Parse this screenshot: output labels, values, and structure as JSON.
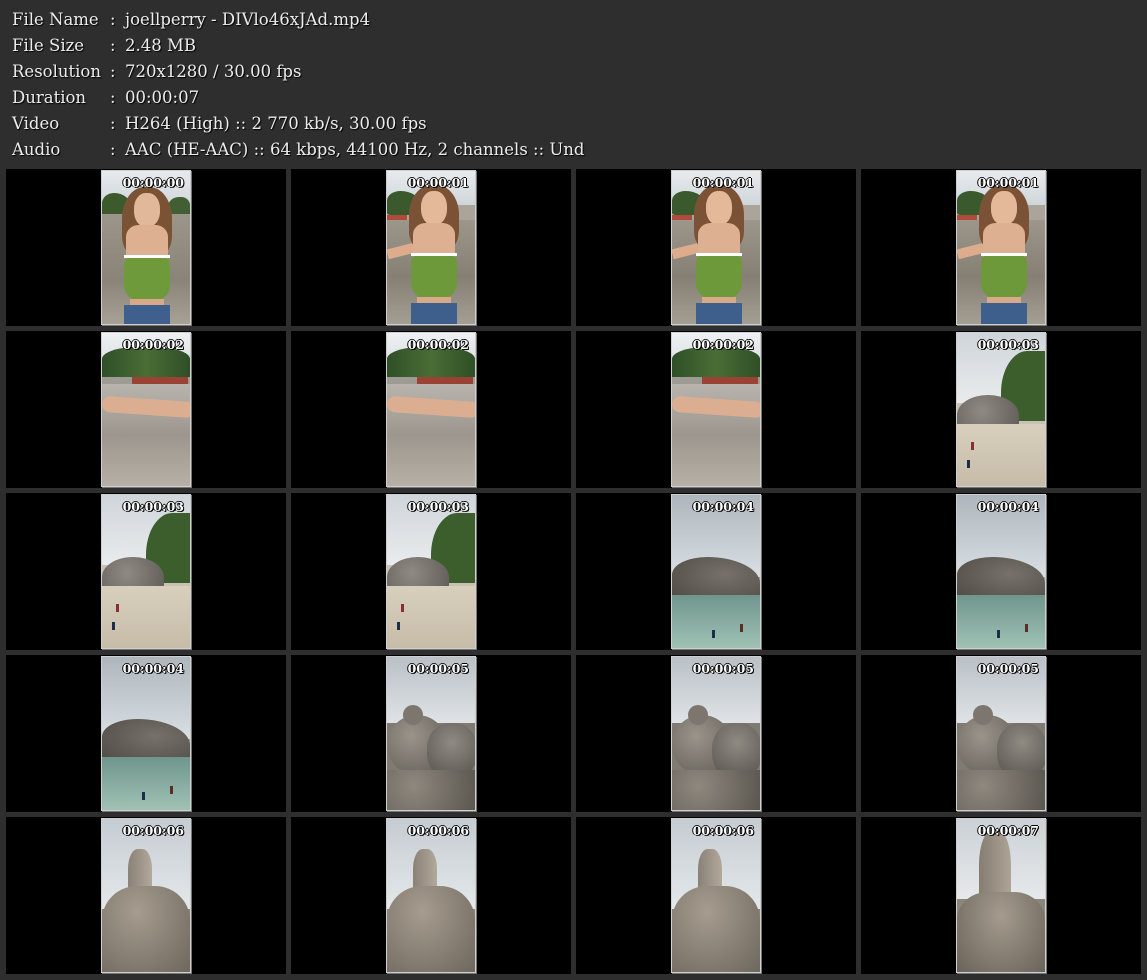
{
  "info": [
    {
      "label": "File Name",
      "value": "joellperry - DIVlo46xJAd.mp4"
    },
    {
      "label": "File Size",
      "value": "2.48 MB"
    },
    {
      "label": "Resolution",
      "value": "720x1280 / 30.00 fps"
    },
    {
      "label": "Duration",
      "value": "00:00:07"
    },
    {
      "label": "Video",
      "value": "H264 (High) :: 2 770 kb/s, 30.00 fps"
    },
    {
      "label": "Audio",
      "value": "AAC (HE-AAC) :: 64 kbps, 44100 Hz, 2 channels :: Und"
    }
  ],
  "separator": ":",
  "thumbnails": [
    {
      "time": "00:00:00",
      "scene": "girl-front"
    },
    {
      "time": "00:00:01",
      "scene": "girl-selfie"
    },
    {
      "time": "00:00:01",
      "scene": "girl-selfie"
    },
    {
      "time": "00:00:01",
      "scene": "girl-selfie"
    },
    {
      "time": "00:00:02",
      "scene": "arm-rocks"
    },
    {
      "time": "00:00:02",
      "scene": "arm-rocks"
    },
    {
      "time": "00:00:02",
      "scene": "arm-rocks"
    },
    {
      "time": "00:00:03",
      "scene": "beach-rocks"
    },
    {
      "time": "00:00:03",
      "scene": "beach-rocks"
    },
    {
      "time": "00:00:03",
      "scene": "beach-rocks"
    },
    {
      "time": "00:00:04",
      "scene": "lagoon-rocks"
    },
    {
      "time": "00:00:04",
      "scene": "lagoon-rocks"
    },
    {
      "time": "00:00:04",
      "scene": "lagoon-rocks"
    },
    {
      "time": "00:00:05",
      "scene": "boulders"
    },
    {
      "time": "00:00:05",
      "scene": "boulders"
    },
    {
      "time": "00:00:05",
      "scene": "boulders"
    },
    {
      "time": "00:00:06",
      "scene": "tall-rock"
    },
    {
      "time": "00:00:06",
      "scene": "tall-rock"
    },
    {
      "time": "00:00:06",
      "scene": "tall-rock"
    },
    {
      "time": "00:00:07",
      "scene": "tall-rock-close"
    }
  ],
  "colors": {
    "background": "#2e2e2e",
    "cell": "#000000",
    "text": "#ececec"
  }
}
